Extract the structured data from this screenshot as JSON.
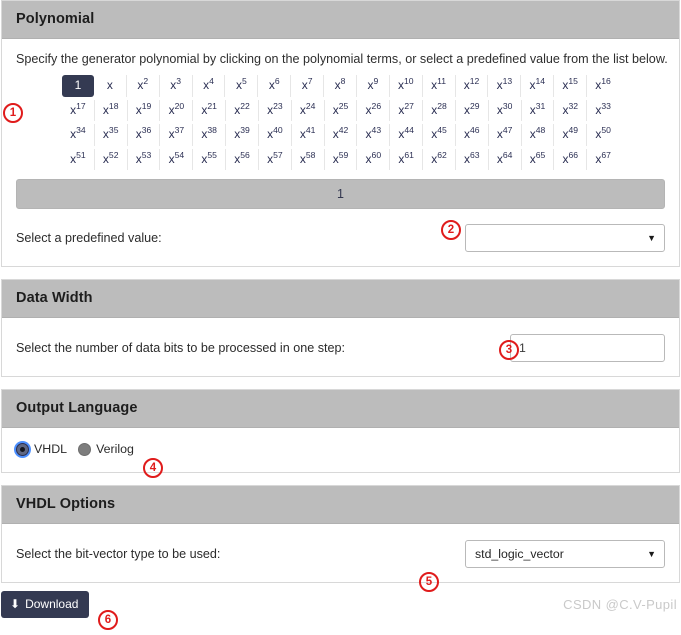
{
  "sections": {
    "polynomial": {
      "title": "Polynomial",
      "description": "Specify the generator polynomial by clicking on the polynomial terms, or select a predefined value from the list below.",
      "terms_rows": [
        [
          "1",
          "x",
          "x2",
          "x3",
          "x4",
          "x5",
          "x6",
          "x7",
          "x8",
          "x9",
          "x10",
          "x11",
          "x12",
          "x13",
          "x14",
          "x15",
          "x16"
        ],
        [
          "x17",
          "x18",
          "x19",
          "x20",
          "x21",
          "x22",
          "x23",
          "x24",
          "x25",
          "x26",
          "x27",
          "x28",
          "x29",
          "x30",
          "x31",
          "x32",
          "x33"
        ],
        [
          "x34",
          "x35",
          "x36",
          "x37",
          "x38",
          "x39",
          "x40",
          "x41",
          "x42",
          "x43",
          "x44",
          "x45",
          "x46",
          "x47",
          "x48",
          "x49",
          "x50"
        ],
        [
          "x51",
          "x52",
          "x53",
          "x54",
          "x55",
          "x56",
          "x57",
          "x58",
          "x59",
          "x60",
          "x61",
          "x62",
          "x63",
          "x64",
          "x65",
          "x66",
          "x67"
        ]
      ],
      "selected_term": "1",
      "result_value": "1",
      "predefined_label": "Select a predefined value:",
      "predefined_value": "",
      "caret": "▼"
    },
    "data_width": {
      "title": "Data Width",
      "label": "Select the number of data bits to be processed in one step:",
      "value": "1"
    },
    "output_language": {
      "title": "Output Language",
      "options": [
        {
          "label": "VHDL",
          "selected": true
        },
        {
          "label": "Verilog",
          "selected": false
        }
      ]
    },
    "vhdl_options": {
      "title": "VHDL Options",
      "label": "Select the bit-vector type to be used:",
      "value": "std_logic_vector",
      "caret": "▼"
    }
  },
  "footer": {
    "download_label": "Download",
    "download_icon": "⬇",
    "watermark": "CSDN @C.V-Pupil"
  },
  "annotations": [
    {
      "id": "1",
      "text": "1"
    },
    {
      "id": "2",
      "text": "2"
    },
    {
      "id": "3",
      "text": "3"
    },
    {
      "id": "4",
      "text": "4"
    },
    {
      "id": "5",
      "text": "5"
    },
    {
      "id": "6",
      "text": "6"
    }
  ],
  "colors": {
    "header_gray": "#bcbcbc",
    "accent_navy": "#343a52",
    "annotation_red": "#e01b1b",
    "term_navy": "#2b2f53"
  }
}
